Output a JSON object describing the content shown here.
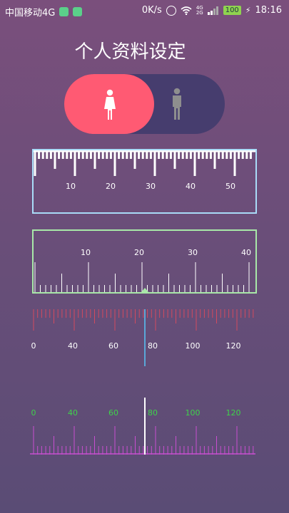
{
  "status_bar": {
    "carrier": "中国移动4G",
    "speed": "0K/s",
    "signal_labels": [
      "4G",
      "2G"
    ],
    "battery": "100",
    "time": "18:16"
  },
  "page_title": "个人资料设定",
  "gender_toggle": {
    "selected": "female",
    "active_color": "#ff5a73",
    "inactive_color": "#463d6e",
    "icons": [
      "female-icon",
      "male-icon"
    ]
  },
  "ruler1": {
    "border_color": "#a9dcf8",
    "labels": [
      "10",
      "20",
      "30",
      "40",
      "50"
    ]
  },
  "ruler2": {
    "border_color": "#a8e8a8",
    "labels": [
      "10",
      "20",
      "30",
      "40"
    ]
  },
  "ruler3": {
    "tick_color": "#d24b5f",
    "indicator_color": "#5aa8d8",
    "labels": [
      "0",
      "40",
      "60",
      "80",
      "100",
      "120"
    ]
  },
  "ruler4": {
    "tick_color": "#c84ed0",
    "label_color": "#3fd34a",
    "indicator_color": "#ffffff",
    "labels": [
      "0",
      "40",
      "60",
      "80",
      "100",
      "120"
    ]
  }
}
